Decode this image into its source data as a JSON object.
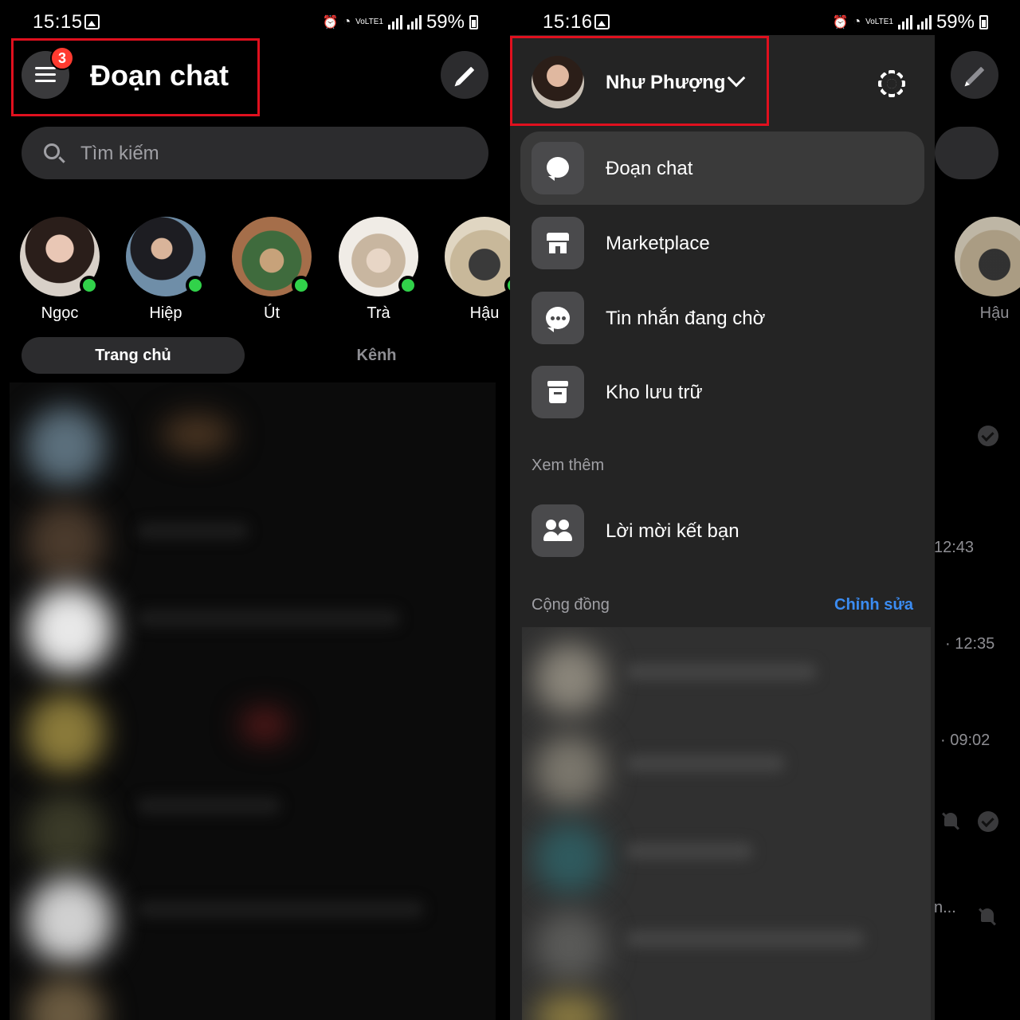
{
  "left": {
    "status": {
      "time": "15:15",
      "signal": "VoLTE1",
      "battery": "59%"
    },
    "header": {
      "title": "Đoạn chat",
      "badge": "3"
    },
    "search": {
      "placeholder": "Tìm kiếm"
    },
    "stories": [
      {
        "name": "Ngọc",
        "online": true
      },
      {
        "name": "Hiệp",
        "online": true
      },
      {
        "name": "Út",
        "online": true
      },
      {
        "name": "Trà",
        "online": true
      },
      {
        "name": "Hậu",
        "online": true
      }
    ],
    "tabs": {
      "home": "Trang chủ",
      "channels": "Kênh"
    }
  },
  "right": {
    "status": {
      "time": "15:16",
      "signal": "VoLTE1",
      "battery": "59%"
    },
    "profile": {
      "name": "Như Phượng"
    },
    "menu": [
      {
        "label": "Đoạn chat",
        "icon": "chat-bubble-icon",
        "active": true
      },
      {
        "label": "Marketplace",
        "icon": "store-icon",
        "active": false
      },
      {
        "label": "Tin nhắn đang chờ",
        "icon": "message-dots-icon",
        "active": false
      },
      {
        "label": "Kho lưu trữ",
        "icon": "archive-icon",
        "active": false
      }
    ],
    "more": {
      "label": "Xem thêm",
      "friend_requests": "Lời mời kết bạn"
    },
    "community": {
      "label": "Cộng đồng",
      "edit": "Chỉnh sửa"
    },
    "background": {
      "story_name": "Hậu",
      "times": [
        "12:43",
        "· 12:35",
        "· 09:02"
      ],
      "truncated": "n..."
    }
  },
  "colors": {
    "accent_link": "#3b8cf2",
    "online_dot": "#31d24a",
    "badge": "#ff3b30",
    "highlight_box": "#e0101e"
  }
}
